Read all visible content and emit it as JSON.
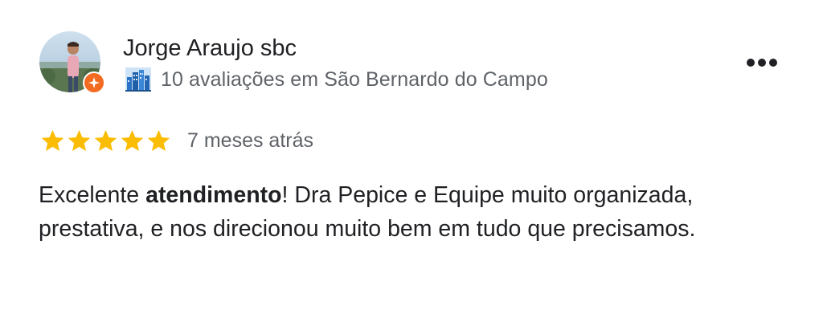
{
  "review": {
    "author_name": "Jorge Araujo sbc",
    "author_subtitle": "10 avaliações em São Bernardo do Campo",
    "rating": 5,
    "rating_max": 5,
    "time_ago": "7 meses atrás",
    "text_part1": "Excelente ",
    "text_bold": "atendimento",
    "text_part2": "! Dra Pepice e Equipe muito organizada, prestativa, e nos direcionou muito bem em tudo que precisamos."
  },
  "icons": {
    "avatar": "avatar",
    "guide_badge": "local-guide-star-icon",
    "city": "city-buildings-icon",
    "more": "more-horizontal-icon",
    "star": "star-icon"
  },
  "colors": {
    "star": "#fbbc04",
    "badge": "#f36b21",
    "secondary_text": "#5f6368",
    "primary_text": "#202124"
  }
}
